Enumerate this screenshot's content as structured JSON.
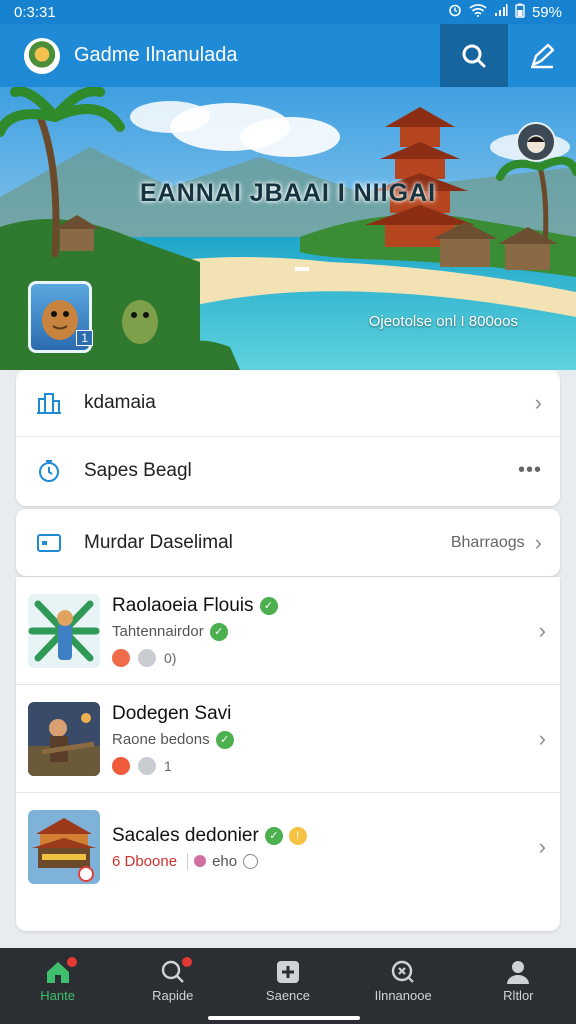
{
  "status": {
    "time": "0:3:31",
    "battery": "59%"
  },
  "app": {
    "title": "Gadme Ilnanulada"
  },
  "hero": {
    "title": "EANNAI JBAAI I NIIGAI",
    "subtitle": "Ojeotolse onl   I 800oos",
    "badge_count": "1"
  },
  "menu": {
    "item1": "kdamaia",
    "item2": "Sapes Beagl",
    "item3": "Murdar Daselimal",
    "item3_value": "Bharraogs"
  },
  "games": [
    {
      "title": "Raolaoeia Flouis",
      "subtitle": "Tahtennairdor",
      "meta": "0)"
    },
    {
      "title": "Dodegen Savi",
      "subtitle": "Raone bedons",
      "meta": "1"
    },
    {
      "title": "Sacales dedonier",
      "subtitle": "6 Dboone",
      "meta": "eho"
    }
  ],
  "nav": [
    {
      "label": "Hante"
    },
    {
      "label": "Rapide"
    },
    {
      "label": "Saence"
    },
    {
      "label": "Ilnnanooe"
    },
    {
      "label": "Rltlor"
    }
  ],
  "colors": {
    "primary": "#1f8ad6",
    "accent_active": "#3fbf6b",
    "nav_bg": "#2b2f34"
  }
}
